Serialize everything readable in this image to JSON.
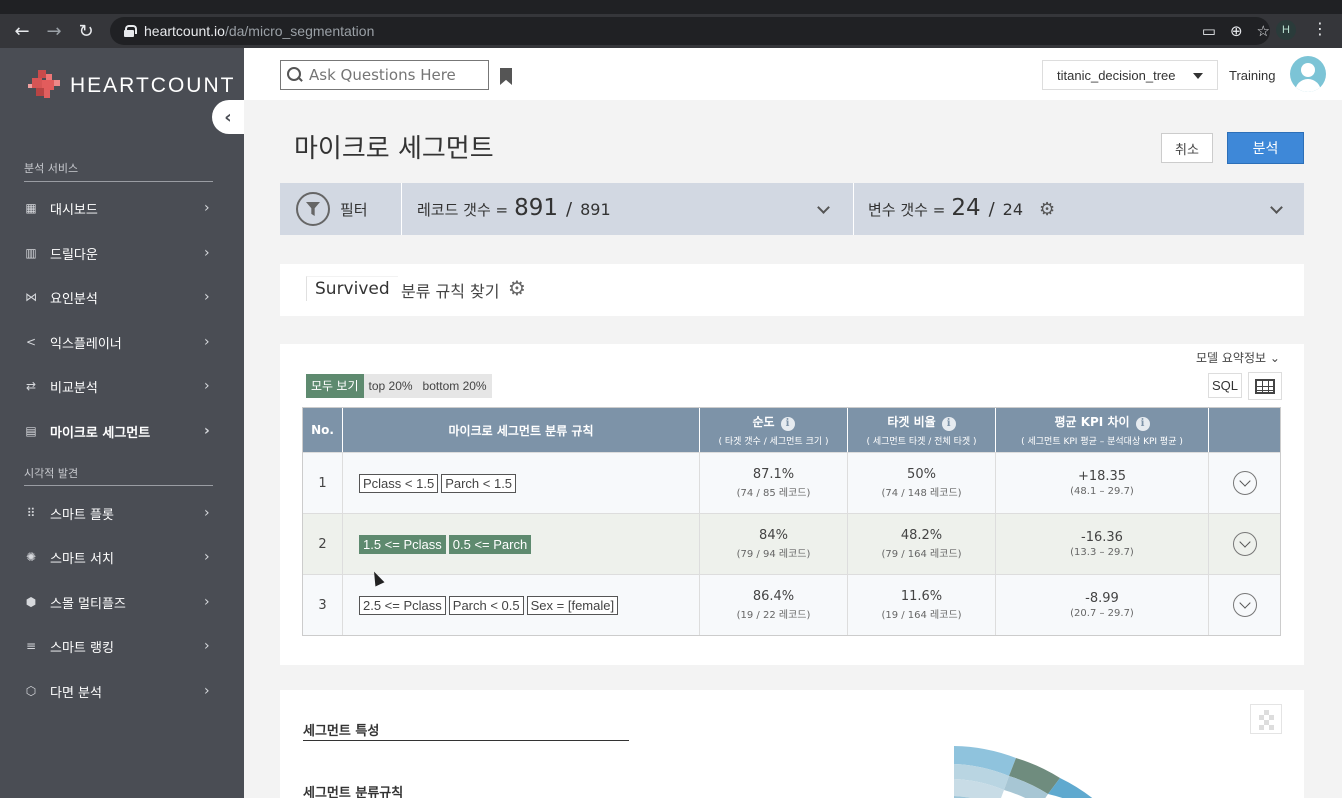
{
  "browser": {
    "url_host": "heartcount.io",
    "url_path": "/da/micro_segmentation",
    "profile_initial": "H"
  },
  "sidebar": {
    "logo_text": "HEARTCOUNT",
    "section1_label": "분석 서비스",
    "section2_label": "시각적 발견",
    "items": [
      {
        "label": "대시보드",
        "icon": "dashboard-icon"
      },
      {
        "label": "드릴다운",
        "icon": "drilldown-icon"
      },
      {
        "label": "요인분석",
        "icon": "factor-icon"
      },
      {
        "label": "익스플레이너",
        "icon": "share-icon"
      },
      {
        "label": "비교분석",
        "icon": "compare-icon"
      },
      {
        "label": "마이크로 세그먼트",
        "icon": "segment-icon"
      },
      {
        "label": "스마트 플롯",
        "icon": "plot-icon"
      },
      {
        "label": "스마트 서치",
        "icon": "search-star-icon"
      },
      {
        "label": "스몰 멀티플즈",
        "icon": "multiples-icon"
      },
      {
        "label": "스마트 랭킹",
        "icon": "ranking-icon"
      },
      {
        "label": "다면 분석",
        "icon": "multi-facet-icon"
      }
    ]
  },
  "header": {
    "search_placeholder": "Ask Questions Here",
    "dataset": "titanic_decision_tree",
    "user": "Training"
  },
  "page": {
    "title": "마이크로 세그먼트",
    "cancel_label": "취소",
    "analyze_label": "분석"
  },
  "filter_bar": {
    "filter_label": "필터",
    "records_label": "레코드 갯수 =",
    "records_selected": "891",
    "records_total": "891",
    "vars_label": "변수 갯수 =",
    "vars_selected": "24",
    "vars_total": "24",
    "separator": "/"
  },
  "target": {
    "name": "Survived",
    "description": "분류 규칙 찾기"
  },
  "results": {
    "model_info": "모델 요약정보 ⌄",
    "view_tabs": [
      "모두 보기",
      "top 20%",
      "bottom 20%"
    ],
    "sql_label": "SQL",
    "headers": {
      "no": "No.",
      "rule": "마이크로 세그먼트 분류 규칙",
      "purity": "순도",
      "purity_sub": "( 타겟 갯수 / 세그먼트 크기 )",
      "target_ratio": "타겟 비율",
      "target_ratio_sub": "( 세그먼트 타겟 / 전체 타겟 )",
      "kpi_diff": "평균 KPI 차이",
      "kpi_diff_sub": "( 세그먼트 KPI 평균 – 분석대상 KPI 평균 )"
    },
    "rows": [
      {
        "no": "1",
        "rules": [
          "Pclass < 1.5",
          "Parch < 1.5"
        ],
        "purity": "87.1%",
        "purity_sub": "(74 / 85 레코드)",
        "ratio": "50%",
        "ratio_sub": "(74 / 148 레코드)",
        "kpi": "+18.35",
        "kpi_sub": "(48.1 – 29.7)"
      },
      {
        "no": "2",
        "rules": [
          "1.5 <= Pclass",
          "0.5 <= Parch"
        ],
        "purity": "84%",
        "purity_sub": "(79 / 94 레코드)",
        "ratio": "48.2%",
        "ratio_sub": "(79 / 164 레코드)",
        "kpi": "-16.36",
        "kpi_sub": "(13.3 – 29.7)"
      },
      {
        "no": "3",
        "rules": [
          "2.5 <= Pclass",
          "Parch < 0.5",
          "Sex = [female]"
        ],
        "purity": "86.4%",
        "purity_sub": "(19 / 22 레코드)",
        "ratio": "11.6%",
        "ratio_sub": "(19 / 164 레코드)",
        "kpi": "-8.99",
        "kpi_sub": "(20.7 – 29.7)"
      }
    ]
  },
  "bottom": {
    "characteristics_title": "세그먼트 특성",
    "rules_title": "세그먼트 분류규칙"
  },
  "colors": {
    "sidebar_bg": "#4a4d54",
    "accent_blue": "#3e88d8",
    "highlight_green": "#5e8a6f",
    "table_header": "#7d93a8"
  }
}
